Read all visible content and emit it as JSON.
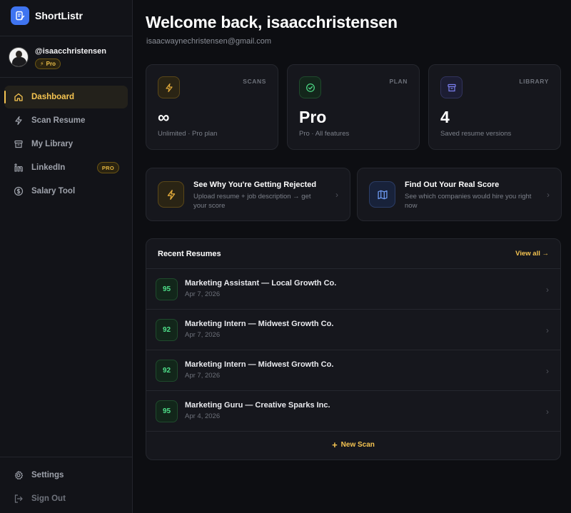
{
  "app": {
    "name": "ShortListr"
  },
  "user": {
    "handle": "@isaacchristensen",
    "plan_badge": "Pro",
    "email": "isaacwaynechristensen@gmail.com"
  },
  "sidebar": {
    "items": [
      {
        "label": "Dashboard",
        "icon": "home-icon",
        "active": true
      },
      {
        "label": "Scan Resume",
        "icon": "bolt-icon"
      },
      {
        "label": "My Library",
        "icon": "archive-icon"
      },
      {
        "label": "LinkedIn",
        "icon": "linkedin-icon",
        "badge": "PRO"
      },
      {
        "label": "Salary Tool",
        "icon": "dollar-icon"
      }
    ],
    "bottom": [
      {
        "label": "Settings",
        "icon": "gear-icon"
      },
      {
        "label": "Sign Out",
        "icon": "sign-out-icon"
      }
    ]
  },
  "header": {
    "welcome": "Welcome back, isaacchristensen"
  },
  "stats": [
    {
      "label": "SCANS",
      "value": "∞",
      "sub": "Unlimited · Pro plan",
      "icon": "bolt-icon",
      "color": "#e0a93a"
    },
    {
      "label": "PLAN",
      "value": "Pro",
      "sub": "Pro · All features",
      "icon": "check-circle-icon",
      "color": "#4fe08a"
    },
    {
      "label": "LIBRARY",
      "value": "4",
      "sub": "Saved resume versions",
      "icon": "archive-icon",
      "color": "#7b7ff0"
    }
  ],
  "actions": [
    {
      "title": "See Why You're Getting Rejected",
      "sub": "Upload resume + job description → get your score",
      "icon": "bolt-icon"
    },
    {
      "title": "Find Out Your Real Score",
      "sub": "See which companies would hire you right now",
      "icon": "map-icon"
    }
  ],
  "recent": {
    "title": "Recent Resumes",
    "view_all": "View all →",
    "rows": [
      {
        "score": "95",
        "title": "Marketing Assistant — Local Growth Co.",
        "date": "Apr 7, 2026"
      },
      {
        "score": "92",
        "title": "Marketing Intern — Midwest Growth Co.",
        "date": "Apr 7, 2026"
      },
      {
        "score": "92",
        "title": "Marketing Intern — Midwest Growth Co.",
        "date": "Apr 7, 2026"
      },
      {
        "score": "95",
        "title": "Marketing Guru — Creative Sparks Inc.",
        "date": "Apr 4, 2026"
      }
    ],
    "new_scan": "New Scan"
  },
  "colors": {
    "accent": "#f5c451",
    "brand": "#3f74f0",
    "success": "#4fe08a"
  }
}
